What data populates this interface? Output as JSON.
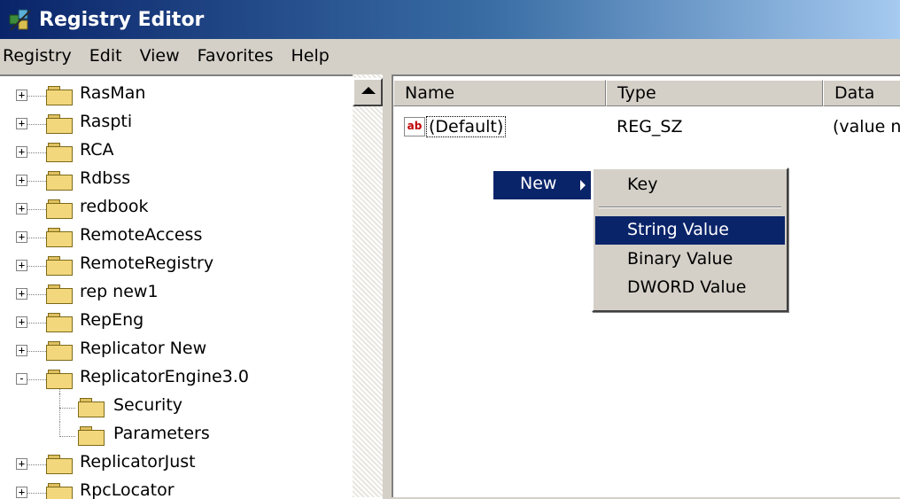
{
  "window": {
    "title": "Registry Editor",
    "icon": "registry-editor-icon"
  },
  "menu": [
    "Registry",
    "Edit",
    "View",
    "Favorites",
    "Help"
  ],
  "tree": {
    "items": [
      {
        "label": "RasMan",
        "expander": "+"
      },
      {
        "label": "Raspti",
        "expander": "+"
      },
      {
        "label": "RCA",
        "expander": "+"
      },
      {
        "label": "Rdbss",
        "expander": "+"
      },
      {
        "label": "redbook",
        "expander": "+"
      },
      {
        "label": "RemoteAccess",
        "expander": "+"
      },
      {
        "label": "RemoteRegistry",
        "expander": "+"
      },
      {
        "label": "rep new1",
        "expander": "+"
      },
      {
        "label": "RepEng",
        "expander": "+"
      },
      {
        "label": "Replicator New",
        "expander": "+"
      },
      {
        "label": "ReplicatorEngine3.0",
        "expander": "-"
      },
      {
        "label": "Security",
        "expander": ""
      },
      {
        "label": "Parameters",
        "expander": ""
      },
      {
        "label": "ReplicatorJust",
        "expander": "+"
      },
      {
        "label": "RpcLocator",
        "expander": "+"
      }
    ]
  },
  "list": {
    "columns": [
      "Name",
      "Type",
      "Data"
    ],
    "rows": [
      {
        "name": "(Default)",
        "type": "REG_SZ",
        "data": "(value n",
        "icon": "string-value-icon"
      }
    ]
  },
  "context_menu": {
    "new_label": "New",
    "submenu": [
      "Key",
      "String Value",
      "Binary Value",
      "DWORD Value"
    ],
    "highlighted": "String Value"
  },
  "colors": {
    "selection": "#0a246a",
    "face": "#d4d0c8"
  }
}
